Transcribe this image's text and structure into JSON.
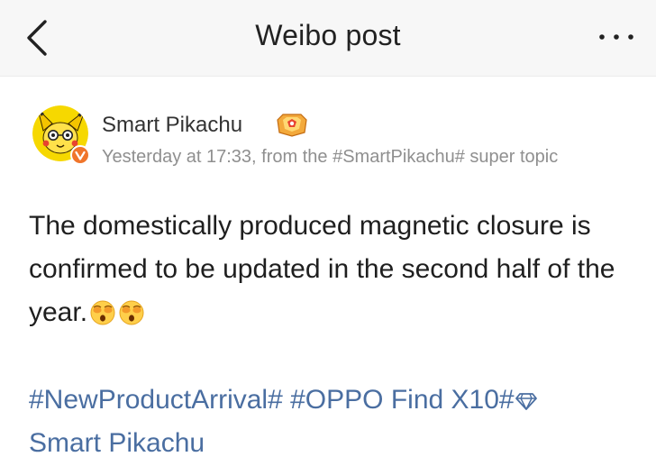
{
  "header": {
    "title": "Weibo post",
    "back_icon": "chevron-left-icon",
    "more_icon": "more-horizontal-icon"
  },
  "post": {
    "author": {
      "name": "Smart Pikachu",
      "avatar_icon": "pikachu-avatar",
      "verified_icon": "verified-badge-icon",
      "badge_icon": "fan-badge-icon"
    },
    "meta": "Yesterday at 17:33, from the #SmartPikachu# super topic",
    "text": "The domestically produced magnetic closure is confirmed to be updated in the second half of the year.",
    "emojis": [
      "shocked-face-emoji",
      "shocked-face-emoji"
    ],
    "topics": [
      "#NewProductArrival#",
      "#OPPO Find X10#"
    ],
    "supertopic_link": "Smart Pikachu",
    "supertopic_icon": "gem-icon"
  },
  "colors": {
    "nav_background": "#f7f7f7",
    "link": "#4a6ea1",
    "meta_text": "#8f8f8f",
    "verified": "#f0752b",
    "avatar_background": "#f6d800"
  }
}
